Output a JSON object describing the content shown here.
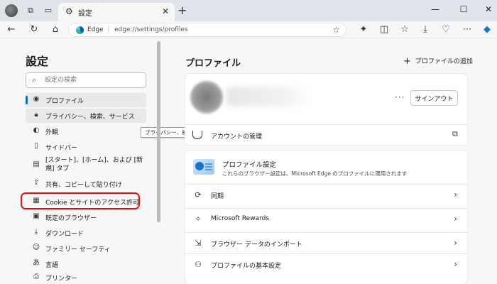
{
  "tab": {
    "title": "設定"
  },
  "address": {
    "site": "Edge",
    "url": "edge://settings/profiles"
  },
  "sidebar": {
    "title": "設定",
    "search_placeholder": "設定の検索",
    "items": [
      {
        "label": "プロファイル",
        "icon": "profile-icon"
      },
      {
        "label": "プライバシー、検索、サービス",
        "icon": "lock-icon"
      },
      {
        "label": "外観",
        "icon": "appearance-icon"
      },
      {
        "label": "サイドバー",
        "icon": "sidebar-icon"
      },
      {
        "label": "[スタート]、[ホーム]、および [新規] タブ",
        "icon": "start-tab-icon"
      },
      {
        "label": "共有、コピーして貼り付け",
        "icon": "share-icon"
      },
      {
        "label": "Cookie とサイトのアクセス許可",
        "icon": "cookie-icon"
      },
      {
        "label": "既定のブラウザー",
        "icon": "default-browser-icon"
      },
      {
        "label": "ダウンロード",
        "icon": "download-icon"
      },
      {
        "label": "ファミリー セーフティ",
        "icon": "family-icon"
      },
      {
        "label": "言語",
        "icon": "language-icon"
      },
      {
        "label": "プリンター",
        "icon": "printer-icon"
      }
    ],
    "tooltip": "プライバシー、検索、サービス"
  },
  "main": {
    "title": "プロファイル",
    "add_profile": "プロファイルの追加",
    "account": {
      "dots": "···",
      "signout": "サインアウト",
      "manage": "アカウントの管理"
    },
    "profile_settings": {
      "title": "プロファイル設定",
      "desc": "これらのブラウザー設定は、Microsoft Edge のプロファイルに適用されます"
    },
    "rows": [
      {
        "label": "同期",
        "icon": "sync-icon"
      },
      {
        "label": "Microsoft Rewards",
        "icon": "rewards-icon"
      },
      {
        "label": "ブラウザー データのインポート",
        "icon": "import-icon"
      },
      {
        "label": "プロファイルの基本設定",
        "icon": "profile-preferences-icon"
      }
    ]
  },
  "colors": {
    "accent": "#0f6cbd",
    "highlight": "#e0101b",
    "titlebar": "#dfe3ea"
  }
}
